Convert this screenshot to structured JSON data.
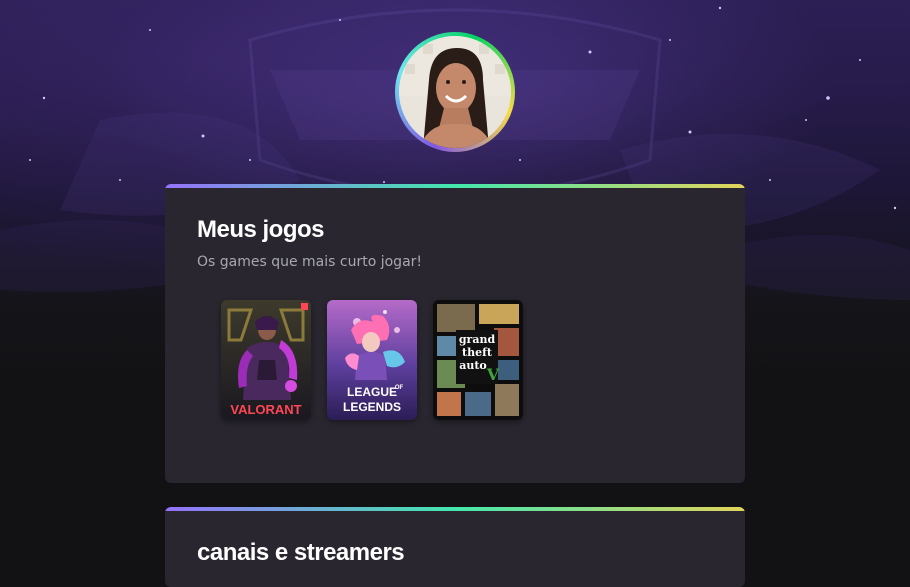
{
  "profile": {
    "avatar_icon": "profile-photo"
  },
  "games_section": {
    "title": "Meus jogos",
    "subtitle": "Os games que mais curto jogar!",
    "games": [
      {
        "name": "Valorant",
        "cover_text": "VALORANT",
        "accent": "#ff4655"
      },
      {
        "name": "League of Legends",
        "cover_text_top": "LEAGUE",
        "cover_text_of": "OF",
        "cover_text_bottom": "LEGENDS",
        "accent": "#c28ad6"
      },
      {
        "name": "Grand Theft Auto V",
        "cover_text_1": "grand",
        "cover_text_2": "theft",
        "cover_text_3": "auto",
        "cover_text_v": "V",
        "accent": "#3ea53e"
      }
    ]
  },
  "streamers_section": {
    "title": "canais e streamers"
  },
  "colors": {
    "page_bg": "#121214",
    "card_bg": "#29262f",
    "gradient_start": "#9572fc",
    "gradient_mid": "#43e7ad",
    "gradient_end": "#e2d45c",
    "text_primary": "#ffffff",
    "text_secondary": "#a8a8b3"
  }
}
